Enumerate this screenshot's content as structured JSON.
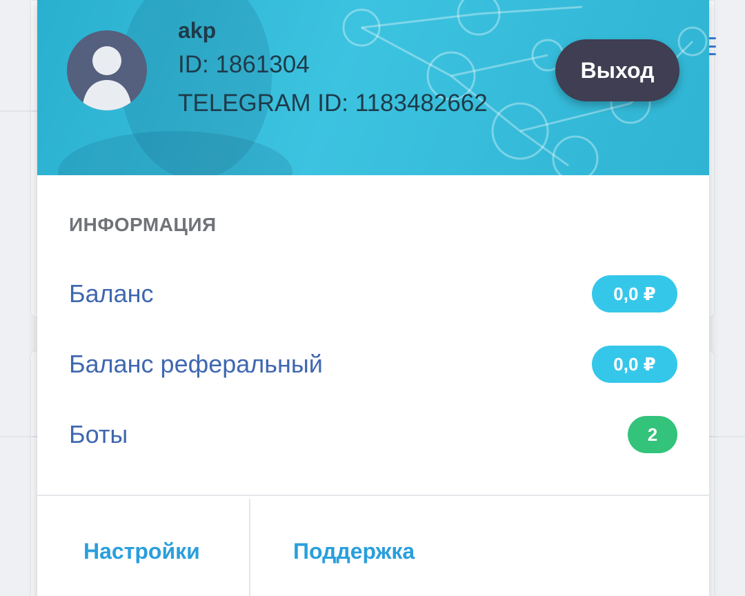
{
  "user": {
    "name": "akp",
    "id_line": "ID: 1861304",
    "telegram_line": "TELEGRAM ID: 1183482662",
    "avatar_icon": "user-avatar-icon",
    "logout_label": "Выход"
  },
  "info": {
    "title": "ИНФОРМАЦИЯ",
    "rows": [
      {
        "label": "Баланс",
        "value": "0,0 ₽",
        "color": "#35c7ea"
      },
      {
        "label": "Баланс реферальный",
        "value": "0,0 ₽",
        "color": "#35c7ea"
      },
      {
        "label": "Боты",
        "value": "2",
        "color": "#33c37b"
      }
    ]
  },
  "footer": {
    "settings_label": "Настройки",
    "support_label": "Поддержка"
  },
  "colors": {
    "header": "#3cc3e0",
    "accent_link": "#2a9fdc",
    "label": "#3f67b0",
    "logout_button": "#3f3e52"
  }
}
